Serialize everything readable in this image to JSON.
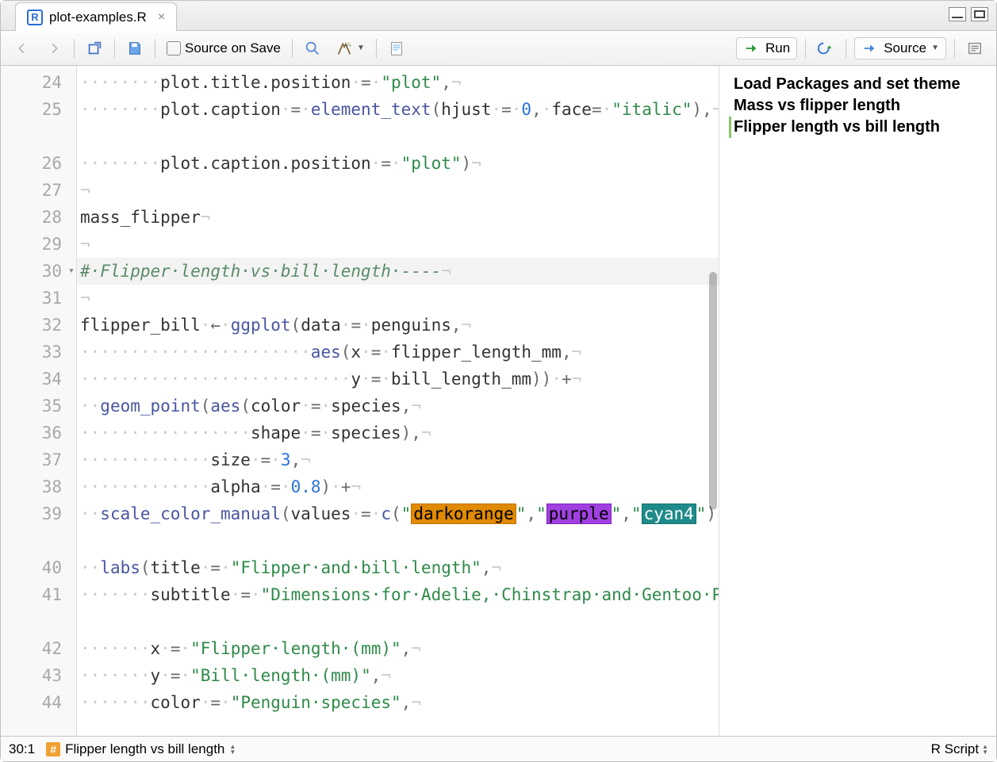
{
  "tab": {
    "filename": "plot-examples.R"
  },
  "toolbar": {
    "source_on_save": "Source on Save",
    "run": "Run",
    "source": "Source"
  },
  "outline": {
    "items": [
      {
        "label": "Load Packages and set theme",
        "active": false
      },
      {
        "label": "Mass vs flipper length",
        "active": false
      },
      {
        "label": "Flipper length vs bill length",
        "active": true
      }
    ]
  },
  "status": {
    "cursor": "30:1",
    "section": "Flipper length vs bill length",
    "language": "R Script"
  },
  "lines": [
    {
      "n": 24,
      "wrap": false,
      "kind": "code",
      "tokens": [
        [
          "ws",
          "········"
        ],
        [
          "id",
          "plot.title.position"
        ],
        [
          "ws",
          "·"
        ],
        [
          "op",
          "="
        ],
        [
          "ws",
          "·"
        ],
        [
          "str",
          "\"plot\""
        ],
        [
          "op",
          ","
        ],
        [
          "ws",
          "¬"
        ]
      ]
    },
    {
      "n": 25,
      "wrap": true,
      "kind": "code",
      "tokens": [
        [
          "ws",
          "········"
        ],
        [
          "id",
          "plot.caption"
        ],
        [
          "ws",
          "·"
        ],
        [
          "op",
          "="
        ],
        [
          "ws",
          "·"
        ],
        [
          "fn",
          "element_text"
        ],
        [
          "op",
          "("
        ],
        [
          "id",
          "hjust"
        ],
        [
          "ws",
          "·"
        ],
        [
          "op",
          "="
        ],
        [
          "ws",
          "·"
        ],
        [
          "num",
          "0"
        ],
        [
          "op",
          ","
        ],
        [
          "ws",
          "·"
        ],
        [
          "id",
          "face"
        ],
        [
          "op",
          "="
        ],
        [
          "ws",
          "·"
        ],
        [
          "str",
          "\"italic\""
        ],
        [
          "op",
          "),"
        ],
        [
          "ws",
          "¬"
        ]
      ]
    },
    {
      "n": 26,
      "wrap": false,
      "kind": "code",
      "tokens": [
        [
          "ws",
          "········"
        ],
        [
          "id",
          "plot.caption.position"
        ],
        [
          "ws",
          "·"
        ],
        [
          "op",
          "="
        ],
        [
          "ws",
          "·"
        ],
        [
          "str",
          "\"plot\""
        ],
        [
          "op",
          ")"
        ],
        [
          "ws",
          "¬"
        ]
      ]
    },
    {
      "n": 27,
      "wrap": false,
      "kind": "code",
      "tokens": [
        [
          "ws",
          "¬"
        ]
      ]
    },
    {
      "n": 28,
      "wrap": false,
      "kind": "code",
      "tokens": [
        [
          "id",
          "mass_flipper"
        ],
        [
          "ws",
          "¬"
        ]
      ]
    },
    {
      "n": 29,
      "wrap": false,
      "kind": "code",
      "tokens": [
        [
          "ws",
          "¬"
        ]
      ]
    },
    {
      "n": 30,
      "wrap": false,
      "kind": "section",
      "fold": true,
      "tokens": [
        [
          "cm",
          "#·Flipper·length·vs·bill·length·----"
        ],
        [
          "ws",
          "¬"
        ]
      ]
    },
    {
      "n": 31,
      "wrap": false,
      "kind": "code",
      "tokens": [
        [
          "ws",
          "¬"
        ]
      ]
    },
    {
      "n": 32,
      "wrap": false,
      "kind": "code",
      "tokens": [
        [
          "id",
          "flipper_bill"
        ],
        [
          "ws",
          "·"
        ],
        [
          "asn",
          "←"
        ],
        [
          "ws",
          "·"
        ],
        [
          "fn",
          "ggplot"
        ],
        [
          "op",
          "("
        ],
        [
          "id",
          "data"
        ],
        [
          "ws",
          "·"
        ],
        [
          "op",
          "="
        ],
        [
          "ws",
          "·"
        ],
        [
          "id",
          "penguins"
        ],
        [
          "op",
          ","
        ],
        [
          "ws",
          "¬"
        ]
      ]
    },
    {
      "n": 33,
      "wrap": false,
      "kind": "code",
      "tokens": [
        [
          "ws",
          "·······················"
        ],
        [
          "fn",
          "aes"
        ],
        [
          "op",
          "("
        ],
        [
          "id",
          "x"
        ],
        [
          "ws",
          "·"
        ],
        [
          "op",
          "="
        ],
        [
          "ws",
          "·"
        ],
        [
          "id",
          "flipper_length_mm"
        ],
        [
          "op",
          ","
        ],
        [
          "ws",
          "¬"
        ]
      ]
    },
    {
      "n": 34,
      "wrap": false,
      "kind": "code",
      "tokens": [
        [
          "ws",
          "···························"
        ],
        [
          "id",
          "y"
        ],
        [
          "ws",
          "·"
        ],
        [
          "op",
          "="
        ],
        [
          "ws",
          "·"
        ],
        [
          "id",
          "bill_length_mm"
        ],
        [
          "op",
          "))"
        ],
        [
          "ws",
          "·"
        ],
        [
          "op",
          "+"
        ],
        [
          "ws",
          "¬"
        ]
      ]
    },
    {
      "n": 35,
      "wrap": false,
      "kind": "code",
      "tokens": [
        [
          "ws",
          "··"
        ],
        [
          "fn",
          "geom_point"
        ],
        [
          "op",
          "("
        ],
        [
          "fn",
          "aes"
        ],
        [
          "op",
          "("
        ],
        [
          "id",
          "color"
        ],
        [
          "ws",
          "·"
        ],
        [
          "op",
          "="
        ],
        [
          "ws",
          "·"
        ],
        [
          "id",
          "species"
        ],
        [
          "op",
          ","
        ],
        [
          "ws",
          "¬"
        ]
      ]
    },
    {
      "n": 36,
      "wrap": false,
      "kind": "code",
      "tokens": [
        [
          "ws",
          "·················"
        ],
        [
          "id",
          "shape"
        ],
        [
          "ws",
          "·"
        ],
        [
          "op",
          "="
        ],
        [
          "ws",
          "·"
        ],
        [
          "id",
          "species"
        ],
        [
          "op",
          "),"
        ],
        [
          "ws",
          "¬"
        ]
      ]
    },
    {
      "n": 37,
      "wrap": false,
      "kind": "code",
      "tokens": [
        [
          "ws",
          "·············"
        ],
        [
          "id",
          "size"
        ],
        [
          "ws",
          "·"
        ],
        [
          "op",
          "="
        ],
        [
          "ws",
          "·"
        ],
        [
          "num",
          "3"
        ],
        [
          "op",
          ","
        ],
        [
          "ws",
          "¬"
        ]
      ]
    },
    {
      "n": 38,
      "wrap": false,
      "kind": "code",
      "tokens": [
        [
          "ws",
          "·············"
        ],
        [
          "id",
          "alpha"
        ],
        [
          "ws",
          "·"
        ],
        [
          "op",
          "="
        ],
        [
          "ws",
          "·"
        ],
        [
          "num",
          "0.8"
        ],
        [
          "op",
          ")"
        ],
        [
          "ws",
          "·"
        ],
        [
          "op",
          "+"
        ],
        [
          "ws",
          "¬"
        ]
      ]
    },
    {
      "n": 39,
      "wrap": true,
      "kind": "code",
      "tokens": [
        [
          "ws",
          "··"
        ],
        [
          "fn",
          "scale_color_manual"
        ],
        [
          "op",
          "("
        ],
        [
          "id",
          "values"
        ],
        [
          "ws",
          "·"
        ],
        [
          "op",
          "="
        ],
        [
          "ws",
          "·"
        ],
        [
          "fn",
          "c"
        ],
        [
          "op",
          "("
        ],
        [
          "str",
          "\""
        ],
        [
          "swatch-darkorange",
          "darkorange"
        ],
        [
          "str",
          "\""
        ],
        [
          "op",
          ","
        ],
        [
          "str",
          "\""
        ],
        [
          "swatch-purple",
          "purple"
        ],
        [
          "str",
          "\""
        ],
        [
          "op",
          ","
        ],
        [
          "str",
          "\""
        ],
        [
          "swatch-cyan4",
          "cyan4"
        ],
        [
          "str",
          "\""
        ],
        [
          "op",
          "))"
        ],
        [
          "ws",
          "·"
        ],
        [
          "op",
          "+"
        ],
        [
          "ws",
          "¬"
        ]
      ]
    },
    {
      "n": 40,
      "wrap": false,
      "kind": "code",
      "tokens": [
        [
          "ws",
          "··"
        ],
        [
          "fn",
          "labs"
        ],
        [
          "op",
          "("
        ],
        [
          "id",
          "title"
        ],
        [
          "ws",
          "·"
        ],
        [
          "op",
          "="
        ],
        [
          "ws",
          "·"
        ],
        [
          "str",
          "\"Flipper·and·bill·length\""
        ],
        [
          "op",
          ","
        ],
        [
          "ws",
          "¬"
        ]
      ]
    },
    {
      "n": 41,
      "wrap": true,
      "kind": "code",
      "tokens": [
        [
          "ws",
          "·······"
        ],
        [
          "id",
          "subtitle"
        ],
        [
          "ws",
          "·"
        ],
        [
          "op",
          "="
        ],
        [
          "ws",
          "·"
        ],
        [
          "str",
          "\"Dimensions·for·Adelie,·Chinstrap·and·Gentoo·Penguins·at·Palmer·Station·LTER\""
        ],
        [
          "op",
          ","
        ],
        [
          "ws",
          "¬"
        ]
      ]
    },
    {
      "n": 42,
      "wrap": false,
      "kind": "code",
      "tokens": [
        [
          "ws",
          "·······"
        ],
        [
          "id",
          "x"
        ],
        [
          "ws",
          "·"
        ],
        [
          "op",
          "="
        ],
        [
          "ws",
          "·"
        ],
        [
          "str",
          "\"Flipper·length·(mm)\""
        ],
        [
          "op",
          ","
        ],
        [
          "ws",
          "¬"
        ]
      ]
    },
    {
      "n": 43,
      "wrap": false,
      "kind": "code",
      "tokens": [
        [
          "ws",
          "·······"
        ],
        [
          "id",
          "y"
        ],
        [
          "ws",
          "·"
        ],
        [
          "op",
          "="
        ],
        [
          "ws",
          "·"
        ],
        [
          "str",
          "\"Bill·length·(mm)\""
        ],
        [
          "op",
          ","
        ],
        [
          "ws",
          "¬"
        ]
      ]
    },
    {
      "n": 44,
      "wrap": false,
      "kind": "code",
      "tokens": [
        [
          "ws",
          "·······"
        ],
        [
          "id",
          "color"
        ],
        [
          "ws",
          "·"
        ],
        [
          "op",
          "="
        ],
        [
          "ws",
          "·"
        ],
        [
          "str",
          "\"Penguin·species\""
        ],
        [
          "op",
          ","
        ],
        [
          "ws",
          "¬"
        ]
      ]
    }
  ]
}
